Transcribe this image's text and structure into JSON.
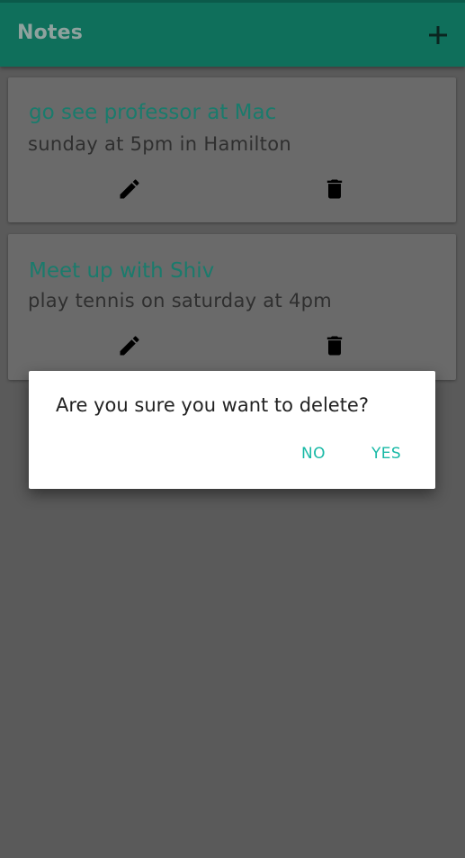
{
  "toolbar": {
    "title": "Notes",
    "add_icon": "plus-icon"
  },
  "notes": [
    {
      "title": "go see professor at Mac",
      "body": "sunday at 5pm in Hamilton",
      "edit_icon": "pencil-icon",
      "delete_icon": "trash-icon"
    },
    {
      "title": "Meet up with Shiv",
      "body": "play tennis on saturday at 4pm",
      "edit_icon": "pencil-icon",
      "delete_icon": "trash-icon"
    }
  ],
  "dialog": {
    "message": "Are you sure you want to delete?",
    "negative_label": "NO",
    "positive_label": "YES"
  },
  "colors": {
    "toolbar": "#0f6f5b",
    "accent": "#18b9a6",
    "title_text": "#1a7b6c",
    "scrim": "#5a5a5a"
  }
}
